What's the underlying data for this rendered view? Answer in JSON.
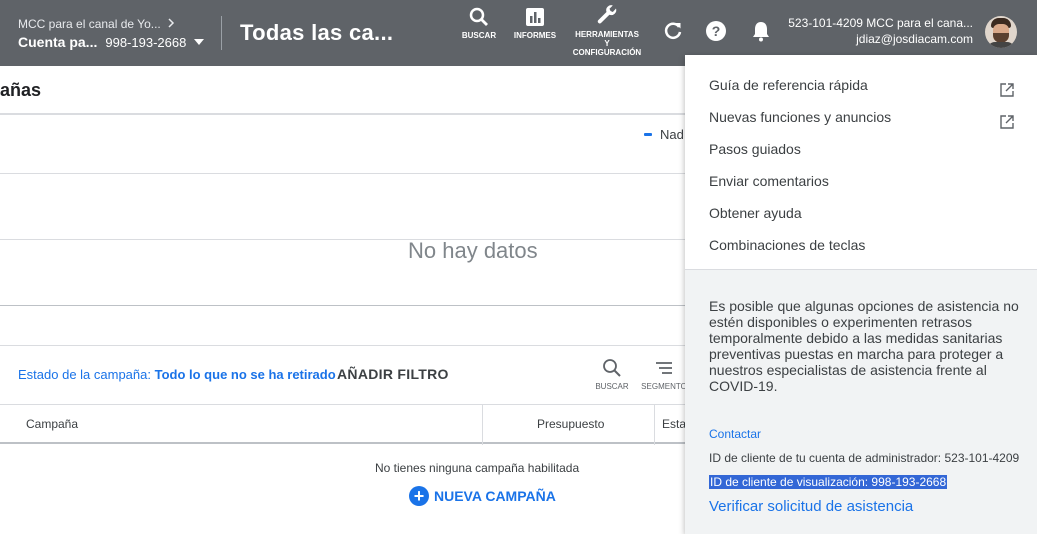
{
  "header": {
    "mcc_label": "MCC para el canal de Yo...",
    "account_name": "Cuenta pa...",
    "account_id": "998-193-2668",
    "page_title": "Todas las ca...",
    "tools": {
      "search": "BUSCAR",
      "reports": "INFORMES",
      "tools_line1": "HERRAMIENTAS",
      "tools_line2": "Y",
      "tools_line3": "CONFIGURACIÓN"
    },
    "user_account": "523-101-4209 MCC para el cana...",
    "user_email": "jdiaz@josdiacam.com"
  },
  "main": {
    "section_title": "añas",
    "legend_label": "Nad",
    "no_data": "No hay datos",
    "filter": {
      "status_label": "Estado de la campaña:",
      "status_value": "Todo lo que no se ha retirado",
      "add_filter": "AÑADIR FILTRO",
      "search_tool": "BUSCAR",
      "segment_tool": "SEGMENTO"
    },
    "table": {
      "columns": [
        "Campaña",
        "Presupuesto",
        "Esta"
      ],
      "empty_message": "No tienes ninguna campaña habilitada",
      "new_campaign": "NUEVA CAMPAÑA"
    }
  },
  "help_panel": {
    "items": [
      "Guía de referencia rápida",
      "Nuevas funciones y anuncios",
      "Pasos guiados",
      "Enviar comentarios",
      "Obtener ayuda",
      "Combinaciones de teclas"
    ],
    "notice": "Es posible que algunas opciones de asistencia no estén disponibles o experimenten retrasos temporalmente debido a las medidas sanitarias preventivas puestas en marcha para proteger a nuestros especialistas de asistencia frente al COVID-19.",
    "contact": "Contactar",
    "admin_client_id": "ID de cliente de tu cuenta de administrador: 523-101-4209",
    "view_client_id": "ID de cliente de visualización: 998-193-2668",
    "verify": "Verificar solicitud de asistencia"
  },
  "colors": {
    "topbar": "#5f6368",
    "accent": "#1a73e8",
    "selection": "#3367d6"
  }
}
